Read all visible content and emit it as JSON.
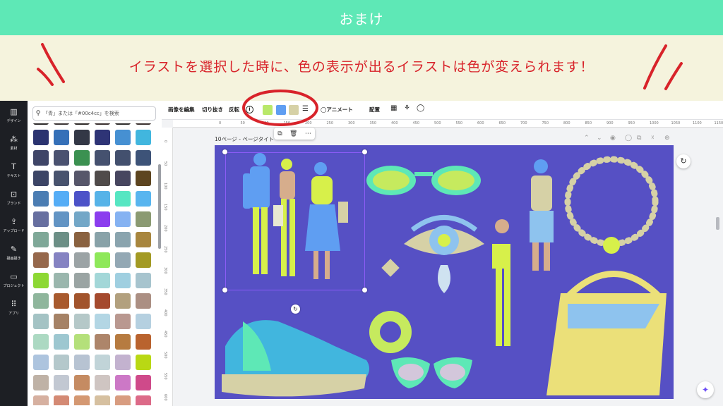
{
  "banner": {
    "title": "おまけ"
  },
  "note": {
    "text": "イラストを選択した時に、色の表示が出るイラストは色が変えられます！"
  },
  "rail": {
    "items": [
      {
        "label": "デザイン",
        "icon": "design-icon",
        "glyph": "▥"
      },
      {
        "label": "素材",
        "icon": "elements-icon",
        "glyph": "⁂"
      },
      {
        "label": "テキスト",
        "icon": "text-icon",
        "glyph": "T"
      },
      {
        "label": "ブランド",
        "icon": "brand-icon",
        "glyph": "⊡"
      },
      {
        "label": "アップロード",
        "icon": "upload-icon",
        "glyph": "⇪"
      },
      {
        "label": "描画描き",
        "icon": "draw-icon",
        "glyph": "✎"
      },
      {
        "label": "プロジェクト",
        "icon": "folder-icon",
        "glyph": "▭"
      },
      {
        "label": "アプリ",
        "icon": "apps-icon",
        "glyph": "⠿"
      }
    ]
  },
  "search": {
    "placeholder": "「青」または「#00c4cc」を検索"
  },
  "swatch_rows": [
    [
      "#2d2a2a",
      "#3b3535",
      "#2e2a28",
      "#3a3030",
      "#2f2d2c",
      "#3b3230"
    ],
    [
      "#2b3370",
      "#3570b8",
      "#333846",
      "#2e3476",
      "#4690d2",
      "#41b6de"
    ],
    [
      "#3f4567",
      "#4a5270",
      "#3b9151",
      "#45516f",
      "#43506e",
      "#3d5378"
    ],
    [
      "#3c4566",
      "#48536e",
      "#56566a",
      "#504b4a",
      "#47465f",
      "#5d4520"
    ],
    [
      "#4b7db3",
      "#55adf6",
      "#4c52c8",
      "#56b3e8",
      "#56e6c2",
      "#58b5ef"
    ],
    [
      "#676fa0",
      "#6294c4",
      "#73a7c7",
      "#8b3dee",
      "#85b2f2",
      "#8b9a72"
    ],
    [
      "#7fa898",
      "#6c8f86",
      "#8a6240",
      "#88a2a8",
      "#8aa4ae",
      "#a8863e"
    ],
    [
      "#96684c",
      "#8583c2",
      "#9ba3a5",
      "#8ee85a",
      "#93a8b4",
      "#a39a24"
    ],
    [
      "#8dd834",
      "#9ab6ad",
      "#9aa4a3",
      "#a3d7d8",
      "#9fcfe0",
      "#a7c4ce"
    ],
    [
      "#8fb69c",
      "#a85a2e",
      "#a2542c",
      "#a54a2e",
      "#b2a07e",
      "#ab8f83"
    ],
    [
      "#a4c3c4",
      "#a58266",
      "#b5c8c8",
      "#b3d6e4",
      "#b99890",
      "#b5d0e0"
    ],
    [
      "#acd9c2",
      "#9dc7d0",
      "#b4e07a",
      "#ad856a",
      "#b67b40",
      "#b9632e"
    ],
    [
      "#adc4de",
      "#b4c8cb",
      "#b7c3d2",
      "#c1d4d8",
      "#c3b2cf",
      "#b9d814"
    ],
    [
      "#bfb2a6",
      "#c2c8d2",
      "#c58b62",
      "#cfc5c2",
      "#cc78c6",
      "#cf4a8a"
    ],
    [
      "#d6b0a0",
      "#d48a74",
      "#d49872",
      "#d6c0a0",
      "#d89c80",
      "#dc6a88"
    ]
  ],
  "toolbar": {
    "edit_image": "画像を編集",
    "crop": "切り抜き",
    "flip": "反転",
    "colors": [
      "#b9e86a",
      "#5f9ef2",
      "#d6d1a6"
    ],
    "animate": "アニメート",
    "position": "配置"
  },
  "ruler_ticks": [
    "0",
    "50",
    "100",
    "150",
    "200",
    "250",
    "300",
    "350",
    "400",
    "450",
    "500",
    "550",
    "600",
    "650",
    "700",
    "750",
    "800",
    "850",
    "900",
    "950",
    "1000",
    "1050",
    "1100",
    "1150",
    "1200"
  ],
  "ruler_v_ticks": [
    "0",
    "50",
    "100",
    "150",
    "200",
    "250",
    "300",
    "350",
    "400",
    "450",
    "500",
    "550",
    "600"
  ],
  "page_label": "10ページ - ページタイト",
  "colors": {
    "canvas": "#5650c4",
    "accent": "#d8232a",
    "banner": "#5ee8b6"
  }
}
